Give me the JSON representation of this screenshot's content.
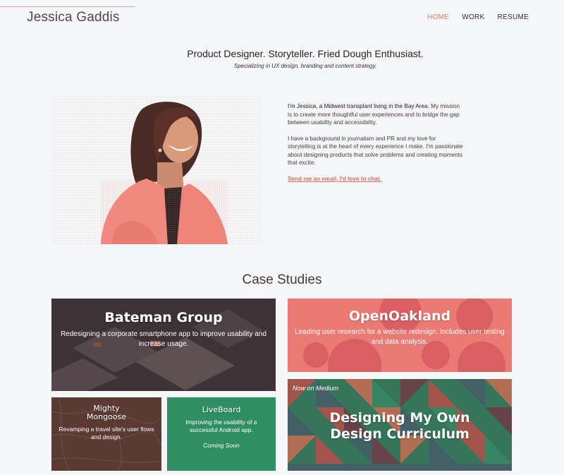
{
  "header": {
    "site_name": "Jessica Gaddis",
    "nav": [
      {
        "label": "HOME",
        "active": true
      },
      {
        "label": "WORK",
        "active": false
      },
      {
        "label": "RESUME",
        "active": false
      }
    ]
  },
  "hero": {
    "tagline": "Product Designer. Storyteller. Fried Dough Enthusiast.",
    "subtagline": "Specializing in UX design, branding and content strategy."
  },
  "intro": {
    "lead": "I'm Jessica, a Midwest transplant living in the Bay Area.",
    "paragraph1_rest": " My mission is to create more thoughtful user experiences and to bridge the gap between usability and accessibility.",
    "paragraph2": "I have a background in journalism and PR and my love for storytelling is at the heart of every experience I make. I'm passionate about designing products that solve problems and creating moments that excite.",
    "email_link": "Send me an email, I'd love to chat."
  },
  "case_studies": {
    "title": "Case Studies",
    "bateman": {
      "title": "Bateman Group",
      "desc": "Redesigning a corporate smartphone app to improve usability and increase usage."
    },
    "openoakland": {
      "title": "OpenOakland",
      "desc": "Leading user research for a website redesign. Includes user testing and data analysis."
    },
    "mighty": {
      "title": "Mighty Mongoose",
      "desc": "Revamping a travel site's user flows and design."
    },
    "liveboard": {
      "title": "LiveBoard",
      "desc": "Improving the usability of a successful Android app.",
      "note": "Coming Soon"
    },
    "medium": {
      "kicker": "Now on Medium",
      "title": "Designing My Own Design Curriculum"
    }
  },
  "colors": {
    "accent": "#e07a67",
    "bateman_bg": "#3d3236",
    "openoakland_bg": "#ec7a74",
    "mighty_bg": "#5a3a33",
    "liveboard_bg": "#2f8f63",
    "medium_bg": "#3d8a6a"
  }
}
